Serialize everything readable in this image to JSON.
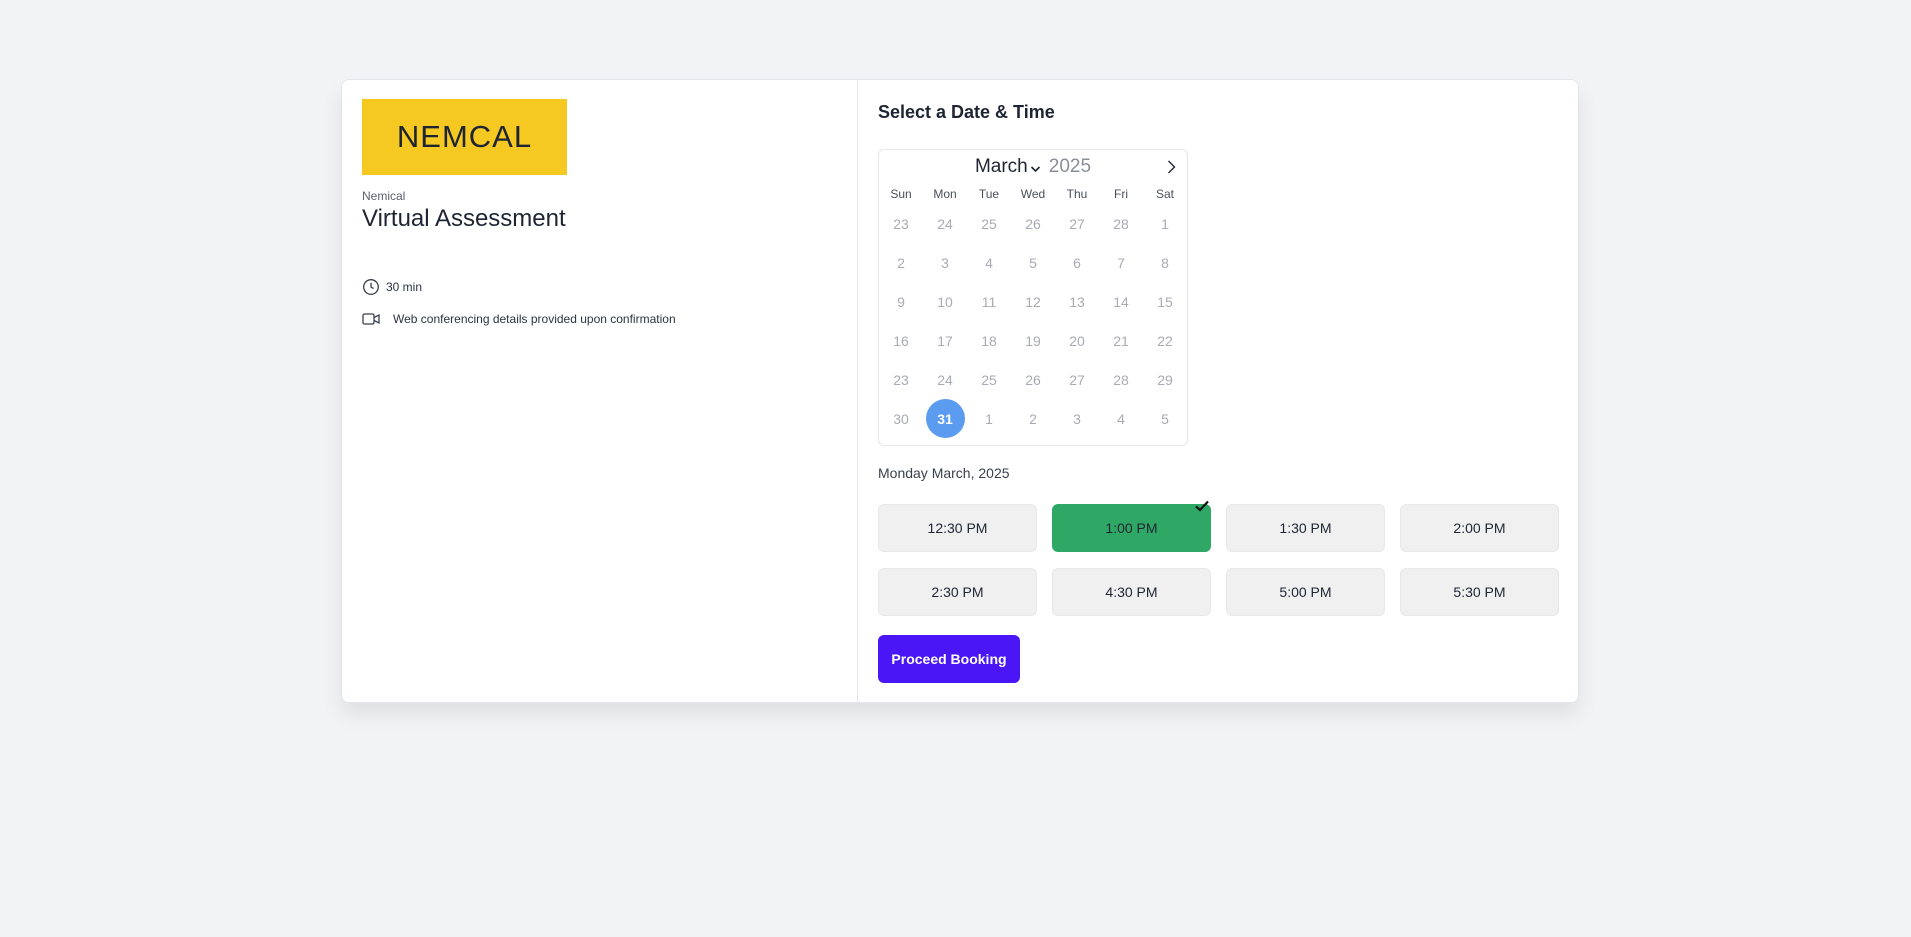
{
  "event": {
    "logo_text": "NEMCAL",
    "organization": "Nemical",
    "title": "Virtual Assessment",
    "duration": "30 min",
    "conferencing": "Web conferencing details provided upon confirmation"
  },
  "scheduler": {
    "title": "Select a Date & Time",
    "month": "March",
    "year": "2025",
    "weekdays": [
      "Sun",
      "Mon",
      "Tue",
      "Wed",
      "Thu",
      "Fri",
      "Sat"
    ],
    "weeks": [
      [
        "23",
        "24",
        "25",
        "26",
        "27",
        "28",
        "1"
      ],
      [
        "2",
        "3",
        "4",
        "5",
        "6",
        "7",
        "8"
      ],
      [
        "9",
        "10",
        "11",
        "12",
        "13",
        "14",
        "15"
      ],
      [
        "16",
        "17",
        "18",
        "19",
        "20",
        "21",
        "22"
      ],
      [
        "23",
        "24",
        "25",
        "26",
        "27",
        "28",
        "29"
      ],
      [
        "30",
        "31",
        "1",
        "2",
        "3",
        "4",
        "5"
      ]
    ],
    "selected_day": "31",
    "selected_date_label": "Monday March, 2025",
    "time_slots": [
      "12:30 PM",
      "1:00 PM",
      "1:30 PM",
      "2:00 PM",
      "2:30 PM",
      "4:30 PM",
      "5:00 PM",
      "5:30 PM"
    ],
    "selected_slot": "1:00 PM",
    "proceed_label": "Proceed Booking"
  },
  "colors": {
    "logo_bg": "#f5c822",
    "selected_day": "#5b9cf0",
    "selected_slot": "#2fa866",
    "proceed_button": "#4a16f5"
  },
  "icons": {
    "duration": "clock-icon",
    "conferencing": "video-camera-icon",
    "next_month": "chevron-right-icon",
    "month_dropdown": "chevron-down-icon",
    "slot_selected": "checkmark-icon"
  }
}
